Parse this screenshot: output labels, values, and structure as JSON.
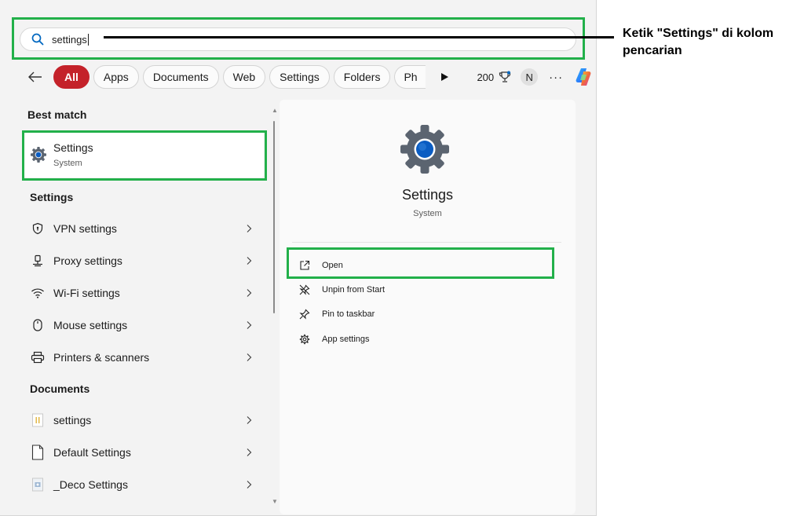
{
  "search": {
    "value": "settings"
  },
  "annotation": {
    "text": "Ketik \"Settings\" di kolom pencarian"
  },
  "filters": {
    "chips": [
      "All",
      "Apps",
      "Documents",
      "Web",
      "Settings",
      "Folders",
      "Ph"
    ],
    "count": "200",
    "avatar_initial": "N",
    "more": "···"
  },
  "results": {
    "best_match_header": "Best match",
    "best_match": {
      "title": "Settings",
      "subtitle": "System"
    },
    "settings_header": "Settings",
    "settings_items": [
      {
        "label": "VPN settings",
        "icon": "shield-icon"
      },
      {
        "label": "Proxy settings",
        "icon": "proxy-icon"
      },
      {
        "label": "Wi-Fi settings",
        "icon": "wifi-icon"
      },
      {
        "label": "Mouse settings",
        "icon": "mouse-icon"
      },
      {
        "label": "Printers & scanners",
        "icon": "printer-icon"
      }
    ],
    "documents_header": "Documents",
    "document_items": [
      {
        "label": "settings",
        "icon": "text-file-icon"
      },
      {
        "label": "Default Settings",
        "icon": "blank-file-icon"
      },
      {
        "label": "_Deco Settings",
        "icon": "image-file-icon"
      }
    ]
  },
  "detail": {
    "title": "Settings",
    "subtitle": "System",
    "actions": [
      {
        "label": "Open",
        "icon": "open-external-icon"
      },
      {
        "label": "Unpin from Start",
        "icon": "unpin-icon"
      },
      {
        "label": "Pin to taskbar",
        "icon": "pin-icon"
      },
      {
        "label": "App settings",
        "icon": "gear-icon"
      }
    ]
  },
  "colors": {
    "highlight": "#22b04a",
    "active_chip": "#c4222a",
    "accent_blue": "#0067c0"
  }
}
